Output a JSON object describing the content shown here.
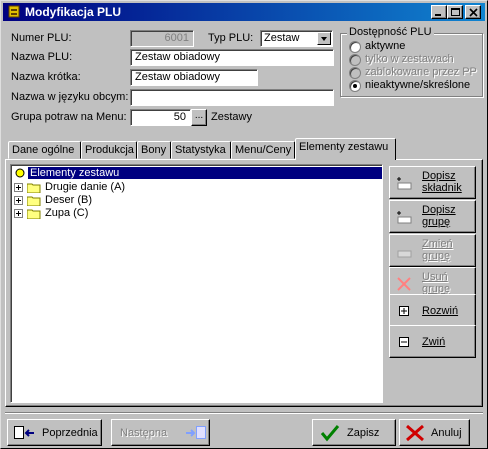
{
  "window": {
    "title": "Modyfikacja PLU"
  },
  "form": {
    "numer_label": "Numer PLU:",
    "numer_value": "6001",
    "typ_label": "Typ PLU:",
    "typ_value": "Zestaw",
    "nazwa_label": "Nazwa PLU:",
    "nazwa_value": "Zestaw obiadowy",
    "krotka_label": "Nazwa krótka:",
    "krotka_value": "Zestaw obiadowy",
    "obca_label": "Nazwa w języku obcym:",
    "obca_value": "",
    "grupa_label": "Grupa potraw na Menu:",
    "grupa_value": "50",
    "grupa_browse": "...",
    "grupa_name": "Zestawy"
  },
  "availability": {
    "title": "Dostępność PLU",
    "options": [
      {
        "label": "aktywne",
        "selected": false,
        "enabled": true
      },
      {
        "label": "tylko w zestawach",
        "selected": false,
        "enabled": false
      },
      {
        "label": "zablokowane przez PP",
        "selected": false,
        "enabled": false
      },
      {
        "label": "nieaktywne/skreślone",
        "selected": true,
        "enabled": true
      }
    ]
  },
  "tabs": [
    {
      "label": "Dane ogólne",
      "active": false
    },
    {
      "label": "Produkcja",
      "active": false
    },
    {
      "label": "Bony",
      "active": false
    },
    {
      "label": "Statystyka",
      "active": false
    },
    {
      "label": "Menu/Ceny",
      "active": false
    },
    {
      "label": "Elementy zestawu",
      "active": true
    }
  ],
  "tree": {
    "root": "Elementy zestawu",
    "children": [
      "Drugie danie (A)",
      "Deser (B)",
      "Zupa (C)"
    ]
  },
  "side_buttons": {
    "dopisz_skladnik": {
      "line1": "Dopisz",
      "line2": "składnik"
    },
    "dopisz_grupe": {
      "line1": "Dopisz",
      "line2": "grupę"
    },
    "zmien_grupe": {
      "line1": "Zmień",
      "line2": "grupę"
    },
    "usun_grupe": {
      "line1": "Usuń",
      "line2": "grupę"
    },
    "rozwin": "Rozwiń",
    "zwin": "Zwiń"
  },
  "bottom_buttons": {
    "poprzednia": "Poprzednia",
    "nastepna": "Następna",
    "zapisz": "Zapisz",
    "anuluj": "Anuluj"
  },
  "colors": {
    "titlebar": "#000080",
    "selection": "#000080",
    "face": "#c0c0c0"
  }
}
